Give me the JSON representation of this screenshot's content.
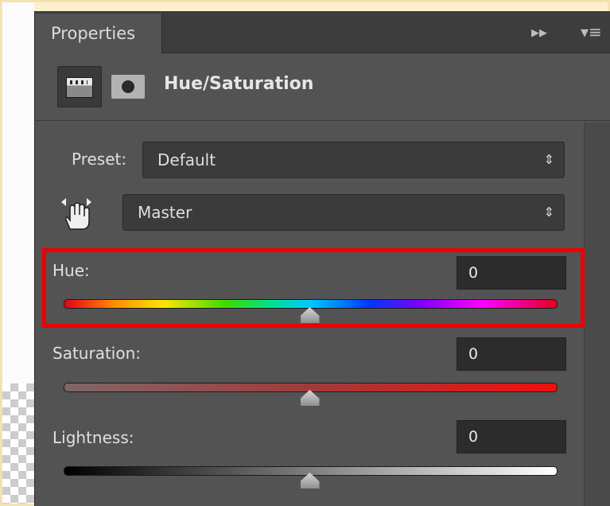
{
  "panel": {
    "tab_label": "Properties",
    "collapse_glyph": "▸▸",
    "menu_glyph": "▾≡",
    "title": "Hue/Saturation",
    "tools": [
      "adjustment-icon",
      "mask-icon"
    ]
  },
  "preset": {
    "label": "Preset:",
    "value": "Default"
  },
  "channel": {
    "value": "Master"
  },
  "select_arrows": "⇕",
  "sliders": {
    "hue": {
      "label": "Hue:",
      "value": "0",
      "position": 0.5
    },
    "saturation": {
      "label": "Saturation:",
      "value": "0",
      "position": 0.5
    },
    "lightness": {
      "label": "Lightness:",
      "value": "0",
      "position": 0.5
    }
  },
  "colors": {
    "highlight": "#ef0000",
    "panel": "#535353"
  }
}
